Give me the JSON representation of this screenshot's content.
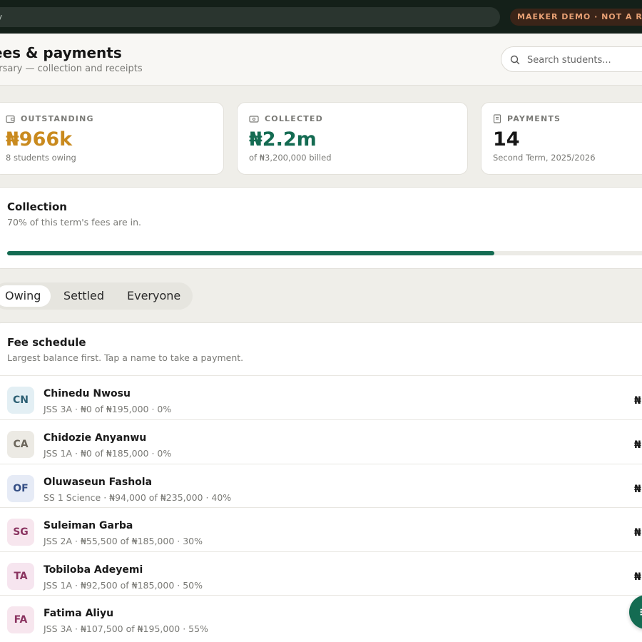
{
  "topbar": {
    "search_text": "y",
    "demo_badge": "MAEKER DEMO · NOT A REAL"
  },
  "header": {
    "title": "ees & payments",
    "subtitle": "ursary — collection and receipts",
    "search_placeholder": "Search students..."
  },
  "stats": [
    {
      "caption": "OUTSTANDING",
      "icon": "wallet-icon",
      "value": "₦966k",
      "sub": "8 students owing",
      "color": "#c98a1e"
    },
    {
      "caption": "COLLECTED",
      "icon": "banknote-icon",
      "value": "₦2.2m",
      "sub": "of ₦3,200,000 billed",
      "color": "#146b52"
    },
    {
      "caption": "PAYMENTS",
      "icon": "receipt-icon",
      "value": "14",
      "sub": "Second Term, 2025/2026",
      "color": "#161616"
    }
  ],
  "collection": {
    "title": "Collection",
    "subtitle": "70% of this term's fees are in.",
    "progress_fraction": 0.75
  },
  "tabs": [
    {
      "label": "Owing",
      "active": true
    },
    {
      "label": "Settled",
      "active": false
    },
    {
      "label": "Everyone",
      "active": false
    }
  ],
  "schedule": {
    "title": "Fee schedule",
    "subtitle": "Largest balance first. Tap a name to take a payment.",
    "rows": [
      {
        "initials": "CN",
        "name": "Chinedu Nwosu",
        "meta": "JSS 3A · ₦0 of ₦195,000 · 0%",
        "amount": "₦",
        "avatar_bg": "#e3eff4",
        "avatar_fg": "#2c5f73"
      },
      {
        "initials": "CA",
        "name": "Chidozie Anyanwu",
        "meta": "JSS 1A · ₦0 of ₦185,000 · 0%",
        "amount": "₦",
        "avatar_bg": "#eceae4",
        "avatar_fg": "#6b655a"
      },
      {
        "initials": "OF",
        "name": "Oluwaseun Fashola",
        "meta": "SS 1 Science · ₦94,000 of ₦235,000 · 40%",
        "amount": "₦",
        "avatar_bg": "#e6ebf6",
        "avatar_fg": "#354f85"
      },
      {
        "initials": "SG",
        "name": "Suleiman Garba",
        "meta": "JSS 2A · ₦55,500 of ₦185,000 · 30%",
        "amount": "₦",
        "avatar_bg": "#f7e6ee",
        "avatar_fg": "#8a3460"
      },
      {
        "initials": "TA",
        "name": "Tobiloba Adeyemi",
        "meta": "JSS 1A · ₦92,500 of ₦185,000 · 50%",
        "amount": "₦",
        "avatar_bg": "#f6e5ef",
        "avatar_fg": "#8a3460"
      },
      {
        "initials": "FA",
        "name": "Fatima Aliyu",
        "meta": "JSS 3A · ₦107,500 of ₦195,000 · 55%",
        "amount": "",
        "avatar_bg": "#f7e6ee",
        "avatar_fg": "#8a3460"
      }
    ]
  },
  "fab": {
    "icon": "add-payment-icon",
    "glyph": "≡"
  }
}
